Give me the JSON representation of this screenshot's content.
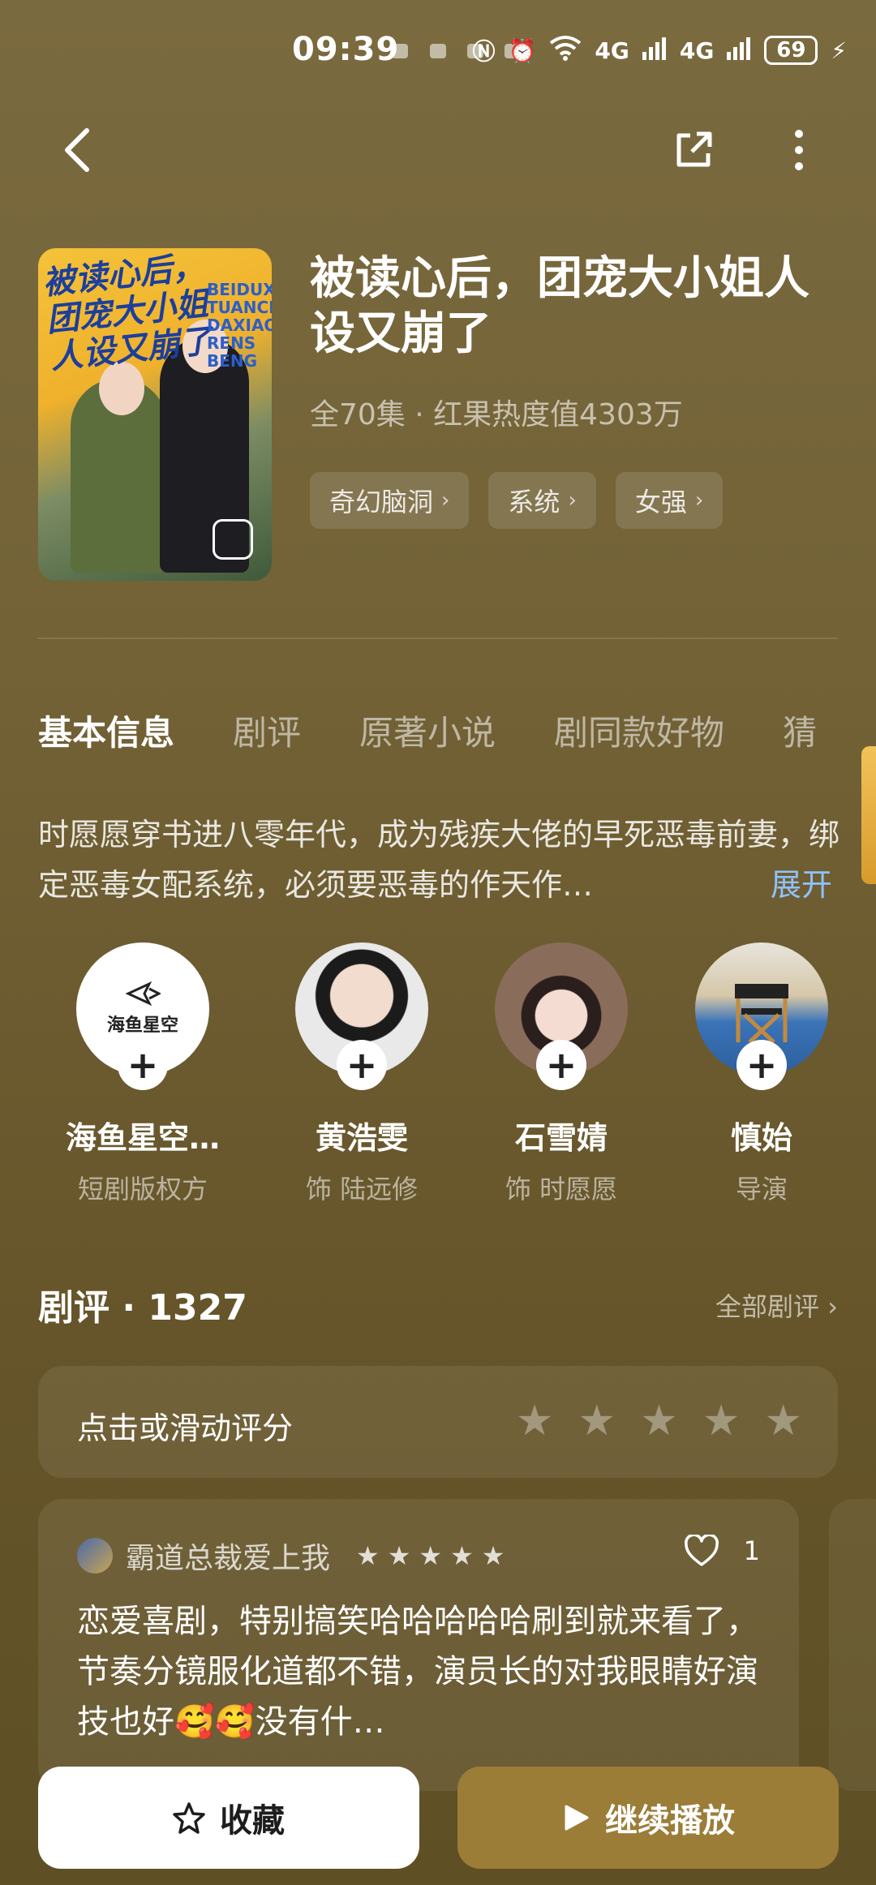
{
  "status": {
    "time": "09:39",
    "network1": "4G",
    "network2": "4G",
    "battery": "69"
  },
  "drama": {
    "title": "被读心后，团宠大小姐人设又崩了",
    "meta": "全70集 · 红果热度值4303万",
    "poster_title": "被读心后，团宠大小姐人设又崩了",
    "poster_en": "BEIDUXIN TUANCHO DAXIAO RENS BENG",
    "tags": [
      {
        "label": "奇幻脑洞"
      },
      {
        "label": "系统"
      },
      {
        "label": "女强"
      }
    ]
  },
  "tabs": [
    {
      "label": "基本信息",
      "active": true
    },
    {
      "label": "剧评"
    },
    {
      "label": "原著小说"
    },
    {
      "label": "剧同款好物"
    },
    {
      "label": "猜"
    }
  ],
  "synopsis": {
    "text": "时愿愿穿书进八零年代，成为残疾大佬的早死恶毒前妻，绑定恶毒女配系统，必须要恶毒的作天作…",
    "expand": "展开"
  },
  "cast": [
    {
      "name": "海鱼星空…",
      "role": "短剧版权方",
      "logo_text": "海鱼星空"
    },
    {
      "name": "黄浩雯",
      "role": "饰 陆远修"
    },
    {
      "name": "石雪婧",
      "role": "饰 时愿愿"
    },
    {
      "name": "慎始",
      "role": "导演"
    }
  ],
  "reviews": {
    "title": "剧评 · 1327",
    "all": "全部剧评 ›",
    "rate_prompt": "点击或滑动评分",
    "rating_max": 5,
    "items": [
      {
        "user": "霸道总裁爱上我",
        "stars": 5,
        "likes": "1",
        "text": "恋爱喜剧，特别搞笑哈哈哈哈哈刷到就来看了，节奏分镜服化道都不错，演员长的对我眼睛好演技也好🥰🥰没有什…"
      }
    ]
  },
  "actions": {
    "collect": "收藏",
    "play": "继续播放"
  },
  "icons": {
    "back": "chevron-left-icon",
    "share": "share-icon",
    "more": "more-vertical-icon",
    "star": "star-icon",
    "heart": "heart-icon",
    "play": "play-icon"
  }
}
